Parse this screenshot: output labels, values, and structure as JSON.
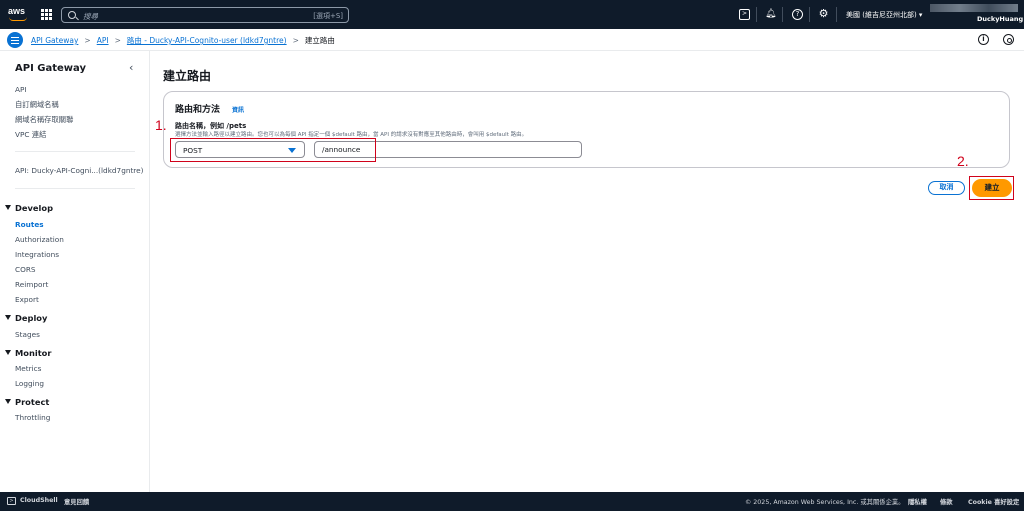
{
  "topnav": {
    "logo": "aws",
    "search_placeholder": "搜尋",
    "search_shortcut": "[選項+S]",
    "region": "美國 (維吉尼亞州北部)",
    "account": "DuckyHuang",
    "icons": [
      "cloudshell-icon",
      "bell-icon",
      "help-icon",
      "gear-icon"
    ]
  },
  "breadcrumb": {
    "items": [
      "API Gateway",
      "API",
      "路由 - Ducky-API-Cognito-user (ldkd7gntre)"
    ],
    "current": "建立路由"
  },
  "sidebar": {
    "title": "API Gateway",
    "top_items": [
      "API",
      "自訂網域名稱",
      "網域名稱存取關聯",
      "VPC 連結"
    ],
    "api_item": "API: Ducky-API-Cogni...(ldkd7gntre)",
    "sections": [
      {
        "title": "Develop",
        "items": [
          "Routes",
          "Authorization",
          "Integrations",
          "CORS",
          "Reimport",
          "Export"
        ]
      },
      {
        "title": "Deploy",
        "items": [
          "Stages"
        ]
      },
      {
        "title": "Monitor",
        "items": [
          "Metrics",
          "Logging"
        ]
      },
      {
        "title": "Protect",
        "items": [
          "Throttling"
        ]
      }
    ],
    "active_item": "Routes"
  },
  "main": {
    "title": "建立路由",
    "card": {
      "heading": "路由和方法",
      "info": "資訊",
      "field_label": "路由名稱，例如 /pets",
      "field_desc": "選擇方法並輸入路徑以建立路由。您也可以為每個 API 指定一個 $default 路由，當 API 的請求沒有對應至其他路由時，會叫用 $default 路由。",
      "method": "POST",
      "path": "/announce"
    },
    "cancel_label": "取消",
    "create_label": "建立"
  },
  "annotations": [
    "1.",
    "2."
  ],
  "footer": {
    "cloudshell": "CloudShell",
    "feedback": "意見回饋",
    "copyright": "© 2025, Amazon Web Services, Inc. 或其關係企業。",
    "privacy": "隱私權",
    "terms": "條款",
    "cookie": "Cookie 喜好設定"
  }
}
